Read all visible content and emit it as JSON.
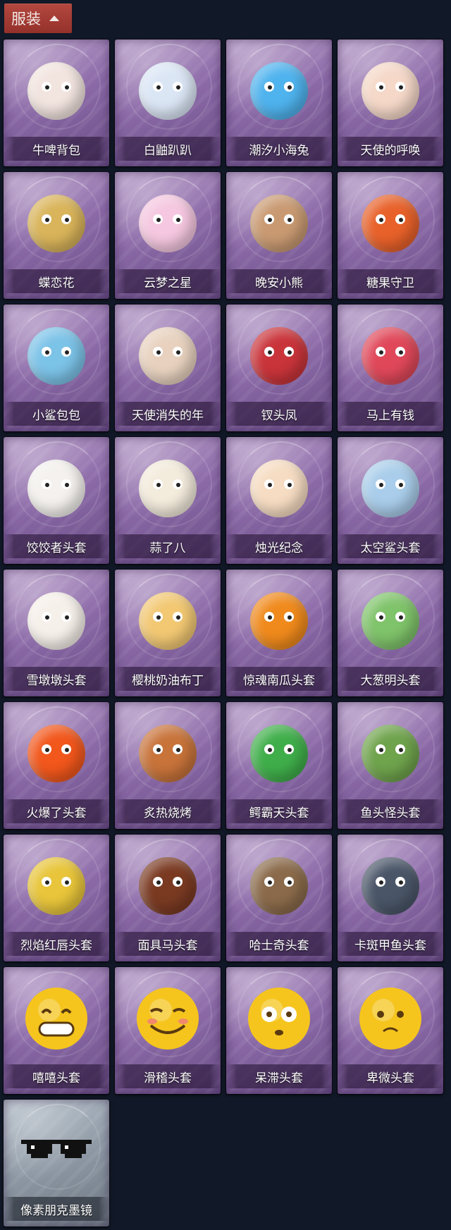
{
  "header": {
    "label": "服装",
    "icon": "chevron-up-icon"
  },
  "items": [
    {
      "label": "牛啤背包",
      "icon": "cow-beer-backpack-icon",
      "color": "#f2e4df"
    },
    {
      "label": "白鼬趴趴",
      "icon": "white-ferret-icon",
      "color": "#dbe6f5"
    },
    {
      "label": "潮汐小海兔",
      "icon": "sea-bunny-icon",
      "color": "#4fb3ee"
    },
    {
      "label": "天使的呼唤",
      "icon": "angel-doll-icon",
      "color": "#f5d8c8"
    },
    {
      "label": "蝶恋花",
      "icon": "butterfly-bell-icon",
      "color": "#d9b45a"
    },
    {
      "label": "云梦之星",
      "icon": "unicorn-cloud-icon",
      "color": "#f5c7e0"
    },
    {
      "label": "晚安小熊",
      "icon": "bear-charm-icon",
      "color": "#c99a72"
    },
    {
      "label": "糖果守卫",
      "icon": "pumpkin-guard-icon",
      "color": "#e8612a"
    },
    {
      "label": "小鲨包包",
      "icon": "shark-bag-icon",
      "color": "#7cc3e8"
    },
    {
      "label": "天使消失的年",
      "icon": "angel-girl-icon",
      "color": "#e8d2bf"
    },
    {
      "label": "钗头凤",
      "icon": "phoenix-crown-icon",
      "color": "#c9343a"
    },
    {
      "label": "马上有钱",
      "icon": "red-horse-icon",
      "color": "#e0485a"
    },
    {
      "label": "饺饺者头套",
      "icon": "dumpling-head-icon",
      "color": "#f4f1ee"
    },
    {
      "label": "蒜了八",
      "icon": "garlic-icon",
      "color": "#f3ebdc"
    },
    {
      "label": "烛光纪念",
      "icon": "candle-icon",
      "color": "#f6dcc2"
    },
    {
      "label": "太空鲨头套",
      "icon": "space-shark-icon",
      "color": "#a9cdea"
    },
    {
      "label": "雪墩墩头套",
      "icon": "snowman-head-icon",
      "color": "#f6f0ea"
    },
    {
      "label": "樱桃奶油布丁",
      "icon": "pudding-icon",
      "color": "#f2c873"
    },
    {
      "label": "惊魂南瓜头套",
      "icon": "jack-o-lantern-icon",
      "color": "#f08a1c"
    },
    {
      "label": "大葱明头套",
      "icon": "scallion-head-icon",
      "color": "#7fc36a"
    },
    {
      "label": "火爆了头套",
      "icon": "fire-head-icon",
      "color": "#f2571c"
    },
    {
      "label": "炙热烧烤",
      "icon": "grill-meat-icon",
      "color": "#c8733a"
    },
    {
      "label": "鳄霸天头套",
      "icon": "crocodile-head-icon",
      "color": "#3fae4a"
    },
    {
      "label": "鱼头怪头套",
      "icon": "fish-head-icon",
      "color": "#6fa34c"
    },
    {
      "label": "烈焰红唇头套",
      "icon": "pikachu-head-icon",
      "color": "#e8c53a"
    },
    {
      "label": "面具马头套",
      "icon": "horse-mask-icon",
      "color": "#7a3a22"
    },
    {
      "label": "哈士奇头套",
      "icon": "husky-head-icon",
      "color": "#8a6a4a"
    },
    {
      "label": "卡斑甲鱼头套",
      "icon": "turtle-head-icon",
      "color": "#4a5668"
    },
    {
      "label": "嘻嘻头套",
      "icon": "grin-emoji-icon",
      "color": "#f5c51e"
    },
    {
      "label": "滑稽头套",
      "icon": "funny-emoji-icon",
      "color": "#f5c51e"
    },
    {
      "label": "呆滞头套",
      "icon": "dazed-emoji-icon",
      "color": "#f5c51e"
    },
    {
      "label": "卑微头套",
      "icon": "humble-emoji-icon",
      "color": "#f5c51e"
    },
    {
      "label": "像素朋克墨镜",
      "icon": "pixel-sunglasses-icon",
      "color": "#111111",
      "rarity": "grey"
    }
  ]
}
